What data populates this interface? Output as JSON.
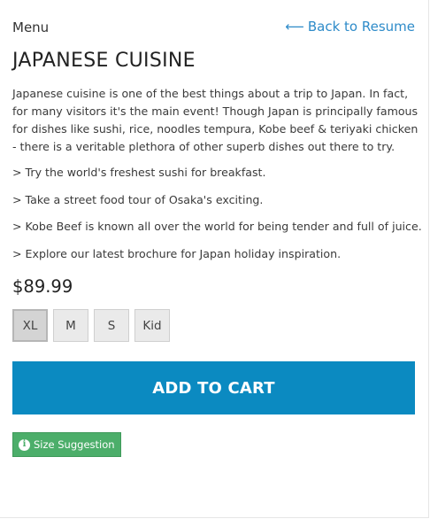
{
  "header": {
    "menu_label": "Menu",
    "back_arrow": "⟵",
    "back_label": "Back to Resume"
  },
  "product": {
    "title": "JAPANESE CUISINE",
    "description": "Japanese cuisine is one of the best things about a trip to Japan. In fact, for many visitors it's the main event! Though Japan is principally famous for dishes like sushi, rice, noodles tempura, Kobe beef & teriyaki chicken - there is a veritable plethora of other superb dishes out there to try.",
    "bullets": [
      "> Try the world's freshest sushi for breakfast.",
      "> Take a street food tour of Osaka's exciting.",
      "> Kobe Beef is known all over the world for being tender and full of juice.",
      "> Explore our latest brochure for Japan holiday inspiration."
    ],
    "price": "$89.99"
  },
  "sizes": {
    "options": [
      "XL",
      "M",
      "S",
      "Kid"
    ],
    "selected": "XL"
  },
  "actions": {
    "add_to_cart_label": "ADD TO CART",
    "size_suggestion_label": "Size Suggestion",
    "size_suggestion_icon": "info-icon"
  },
  "colors": {
    "link": "#2e8bc9",
    "primary_button": "#0b8ac1",
    "suggestion_badge": "#4cae6a"
  }
}
